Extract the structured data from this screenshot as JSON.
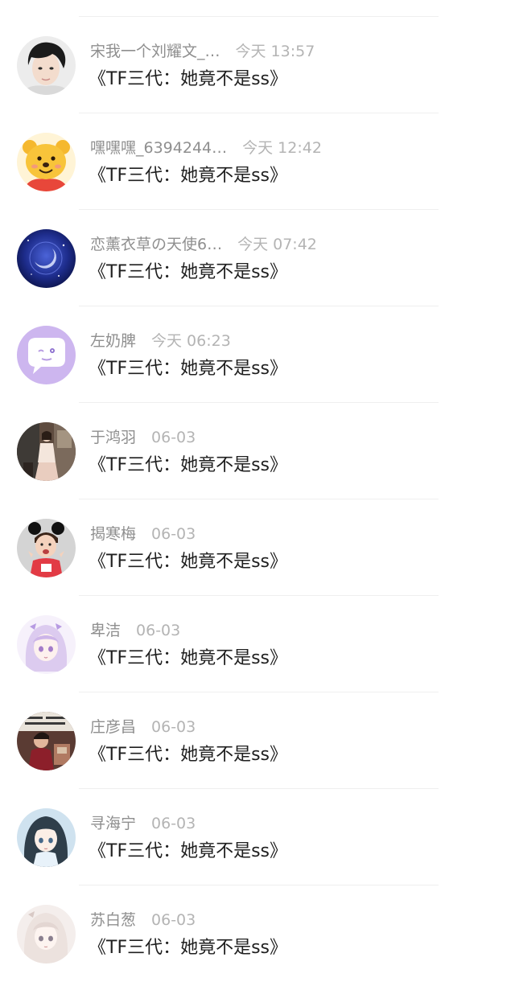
{
  "messages": [
    {
      "name": "宋我一个刘耀文_…",
      "time": "今天  13:57",
      "text": "《TF三代：她竟不是ss》",
      "avatar_icon": "boy-portrait-avatar",
      "avatar_color": "#2b2b2b"
    },
    {
      "name": "嘿嘿嘿_6394244…",
      "time": "今天  12:42",
      "text": "《TF三代：她竟不是ss》",
      "avatar_icon": "cartoon-bear-avatar",
      "avatar_color": "#f5b82e"
    },
    {
      "name": "恋薰衣草の天使6…",
      "time": "今天  07:42",
      "text": "《TF三代：她竟不是ss》",
      "avatar_icon": "moon-night-sky-avatar",
      "avatar_color": "#1c2f8f"
    },
    {
      "name": "左奶脾",
      "time": "今天  06:23",
      "text": "《TF三代：她竟不是ss》",
      "avatar_icon": "chat-bubble-avatar",
      "avatar_color": "#c9b3ec"
    },
    {
      "name": "于鸿羽",
      "time": "06-03",
      "text": "《TF三代：她竟不是ss》",
      "avatar_icon": "girl-photo-avatar",
      "avatar_color": "#6b5548"
    },
    {
      "name": "揭寒梅",
      "time": "06-03",
      "text": "《TF三代：她竟不是ss》",
      "avatar_icon": "child-mouse-ears-avatar",
      "avatar_color": "#c8c8c8"
    },
    {
      "name": "卑洁",
      "time": "06-03",
      "text": "《TF三代：她竟不是ss》",
      "avatar_icon": "anime-girl-purple-avatar",
      "avatar_color": "#e9e0f2"
    },
    {
      "name": "庄彦昌",
      "time": "06-03",
      "text": "《TF三代：她竟不是ss》",
      "avatar_icon": "meme-photo-avatar",
      "avatar_color": "#5a3b33"
    },
    {
      "name": "寻海宁",
      "time": "06-03",
      "text": "《TF三代：她竟不是ss》",
      "avatar_icon": "anime-girl-blue-avatar",
      "avatar_color": "#aac8de"
    },
    {
      "name": "苏白葱",
      "time": "06-03",
      "text": "《TF三代：她竟不是ss》",
      "avatar_icon": "anime-girl-white-avatar",
      "avatar_color": "#eee6e4"
    }
  ]
}
